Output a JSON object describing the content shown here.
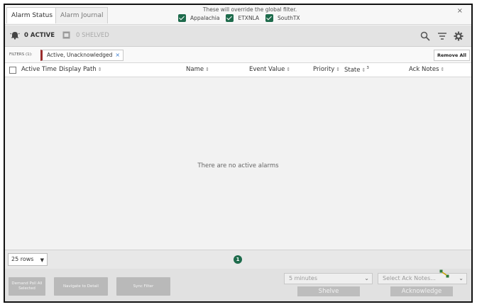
{
  "tabs": [
    {
      "label": "Alarm Status",
      "active": true
    },
    {
      "label": "Alarm Journal",
      "active": false
    }
  ],
  "override_text": "These will override the global filter.",
  "regions": [
    {
      "label": "Appalachia",
      "checked": true
    },
    {
      "label": "ETXNLA",
      "checked": true
    },
    {
      "label": "SouthTX",
      "checked": true
    }
  ],
  "close_glyph": "×",
  "status": {
    "active_label": "0 ACTIVE",
    "shelved_label": "0 SHELVED"
  },
  "toolbar_icons": [
    "search-icon",
    "filter-icon",
    "gear-icon"
  ],
  "filters": {
    "label": "FILTERS (1):",
    "chip_text": "Active, Unacknowledged",
    "chip_remove": "×",
    "remove_all": "Remove All"
  },
  "columns": {
    "active_time": "Active Time",
    "display_path": "Display Path",
    "name": "Name",
    "event_value": "Event Value",
    "priority": "Priority",
    "state": "State",
    "state_rank": "3",
    "ack_notes": "Ack Notes"
  },
  "empty_message": "There are no active alarms",
  "pager": {
    "rows_value": "25 rows",
    "page": "1"
  },
  "actions": {
    "demand_poll": "Demand Poll All Selected",
    "navigate": "Navigate to Detail",
    "sync_filter": "Sync Filter",
    "shelve_duration": "5 minutes",
    "shelve": "Shelve",
    "ack_notes_placeholder": "Select Ack Notes...",
    "acknowledge": "Acknowledge"
  },
  "colors": {
    "accent_green": "#1e6b4c",
    "chip_border": "#9b2d2d"
  }
}
